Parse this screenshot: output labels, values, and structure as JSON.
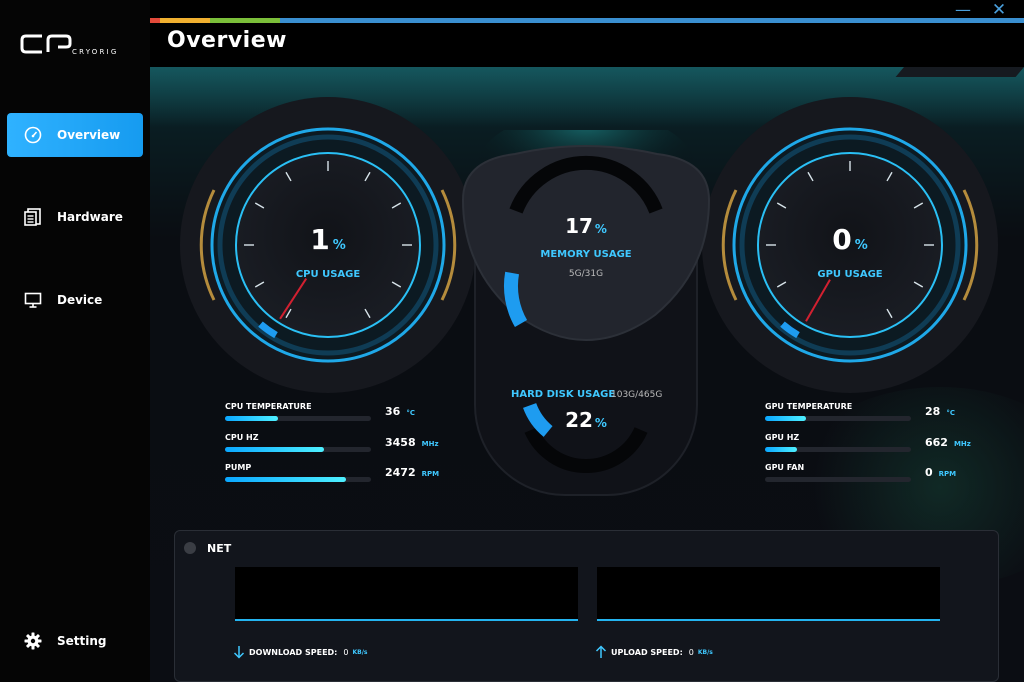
{
  "app": {
    "logo_text": "CRYORIG",
    "title": "Overview",
    "stripe_colors": [
      "#e24a3a",
      "#f0b030",
      "#7bbf3a",
      "#3a8fd0"
    ],
    "accent": "#3fc8ff",
    "window_controls": {
      "minimize": "—",
      "close": "✕"
    }
  },
  "sidebar": {
    "items": [
      {
        "label": "Overview",
        "icon": "speedometer-icon",
        "active": true
      },
      {
        "label": "Hardware",
        "icon": "hardware-icon",
        "active": false
      },
      {
        "label": "Device",
        "icon": "monitor-icon",
        "active": false
      },
      {
        "label": "Setting",
        "icon": "gear-icon",
        "active": false
      }
    ]
  },
  "cpu": {
    "usage_value": "1",
    "usage_unit": "%",
    "usage_fraction": 0.01,
    "usage_label": "CPU USAGE",
    "stats": [
      {
        "label": "CPU TEMPERATURE",
        "value": "36",
        "unit": "°C",
        "fill": 0.36
      },
      {
        "label": "CPU HZ",
        "value": "3458",
        "unit": "MHz",
        "fill": 0.68
      },
      {
        "label": "PUMP",
        "value": "2472",
        "unit": "RPM",
        "fill": 0.83
      }
    ]
  },
  "gpu": {
    "usage_value": "0",
    "usage_unit": "%",
    "usage_fraction": 0.0,
    "usage_label": "GPU USAGE",
    "stats": [
      {
        "label": "GPU TEMPERATURE",
        "value": "28",
        "unit": "°C",
        "fill": 0.28
      },
      {
        "label": "GPU HZ",
        "value": "662",
        "unit": "MHz",
        "fill": 0.22
      },
      {
        "label": "GPU FAN",
        "value": "0",
        "unit": "RPM",
        "fill": 0.0
      }
    ]
  },
  "memory": {
    "value": "17",
    "unit": "%",
    "fraction": 0.17,
    "label": "MEMORY USAGE",
    "detail": "5G/31G"
  },
  "disk": {
    "value": "22",
    "unit": "%",
    "fraction": 0.22,
    "label": "HARD DISK USAGE",
    "detail": "103G/465G"
  },
  "net": {
    "title": "NET",
    "download_label": "DOWNLOAD SPEED:",
    "download_value": "0",
    "upload_label": "UPLOAD SPEED:",
    "upload_value": "0",
    "speed_unit": "KB/s"
  }
}
